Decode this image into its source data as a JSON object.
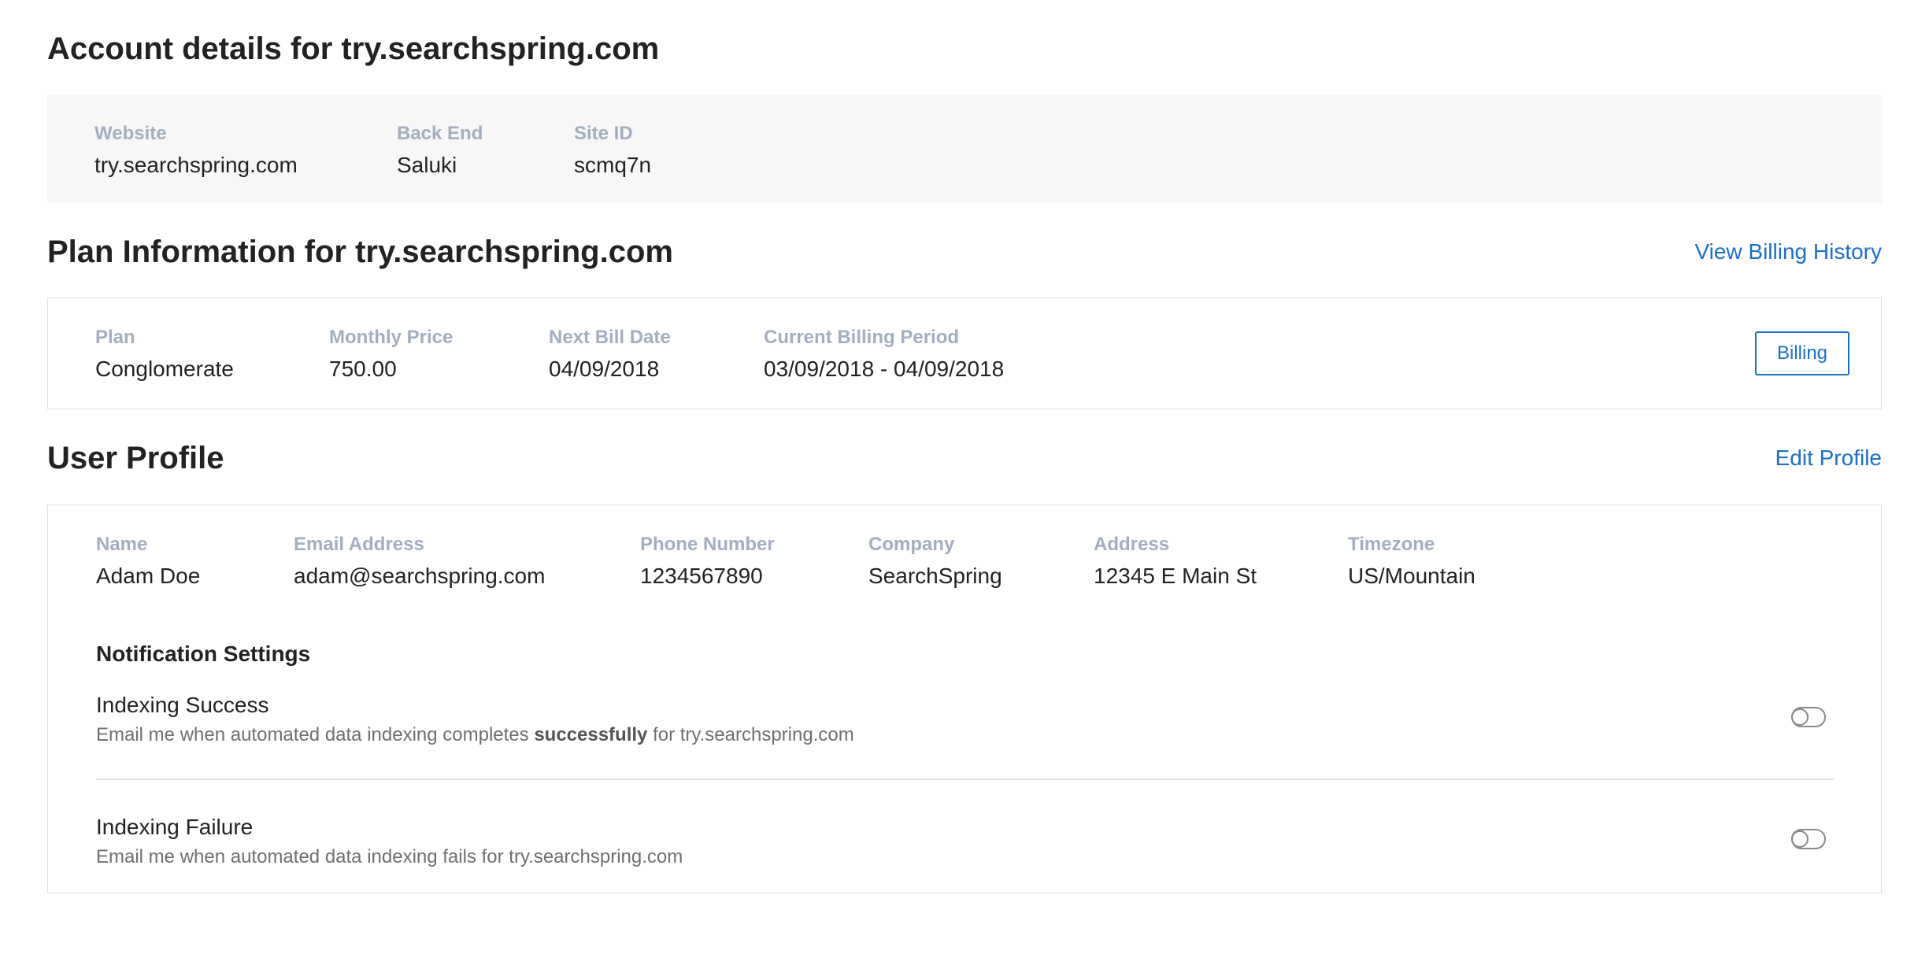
{
  "account": {
    "title": "Account details for try.searchspring.com",
    "fields": [
      {
        "label": "Website",
        "value": "try.searchspring.com"
      },
      {
        "label": "Back End",
        "value": "Saluki"
      },
      {
        "label": "Site ID",
        "value": "scmq7n"
      }
    ]
  },
  "plan": {
    "title": "Plan Information for try.searchspring.com",
    "history_link": "View Billing History",
    "billing_button": "Billing",
    "fields": [
      {
        "label": "Plan",
        "value": "Conglomerate"
      },
      {
        "label": "Monthly Price",
        "value": "750.00"
      },
      {
        "label": "Next Bill Date",
        "value": "04/09/2018"
      },
      {
        "label": "Current Billing Period",
        "value": "03/09/2018 - 04/09/2018"
      }
    ]
  },
  "profile": {
    "title": "User Profile",
    "edit_link": "Edit Profile",
    "fields": [
      {
        "label": "Name",
        "value": "Adam Doe"
      },
      {
        "label": "Email Address",
        "value": "adam@searchspring.com"
      },
      {
        "label": "Phone Number",
        "value": "1234567890"
      },
      {
        "label": "Company",
        "value": "SearchSpring"
      },
      {
        "label": "Address",
        "value": "12345 E Main St"
      },
      {
        "label": "Timezone",
        "value": "US/Mountain"
      }
    ],
    "notifications": {
      "heading": "Notification Settings",
      "items": [
        {
          "title": "Indexing Success",
          "desc_before": "Email me when automated data indexing completes ",
          "desc_bold": "successfully",
          "desc_after": " for try.searchspring.com",
          "enabled": false
        },
        {
          "title": "Indexing Failure",
          "desc_before": "Email me when automated data indexing fails for try.searchspring.com",
          "enabled": false
        }
      ]
    }
  }
}
